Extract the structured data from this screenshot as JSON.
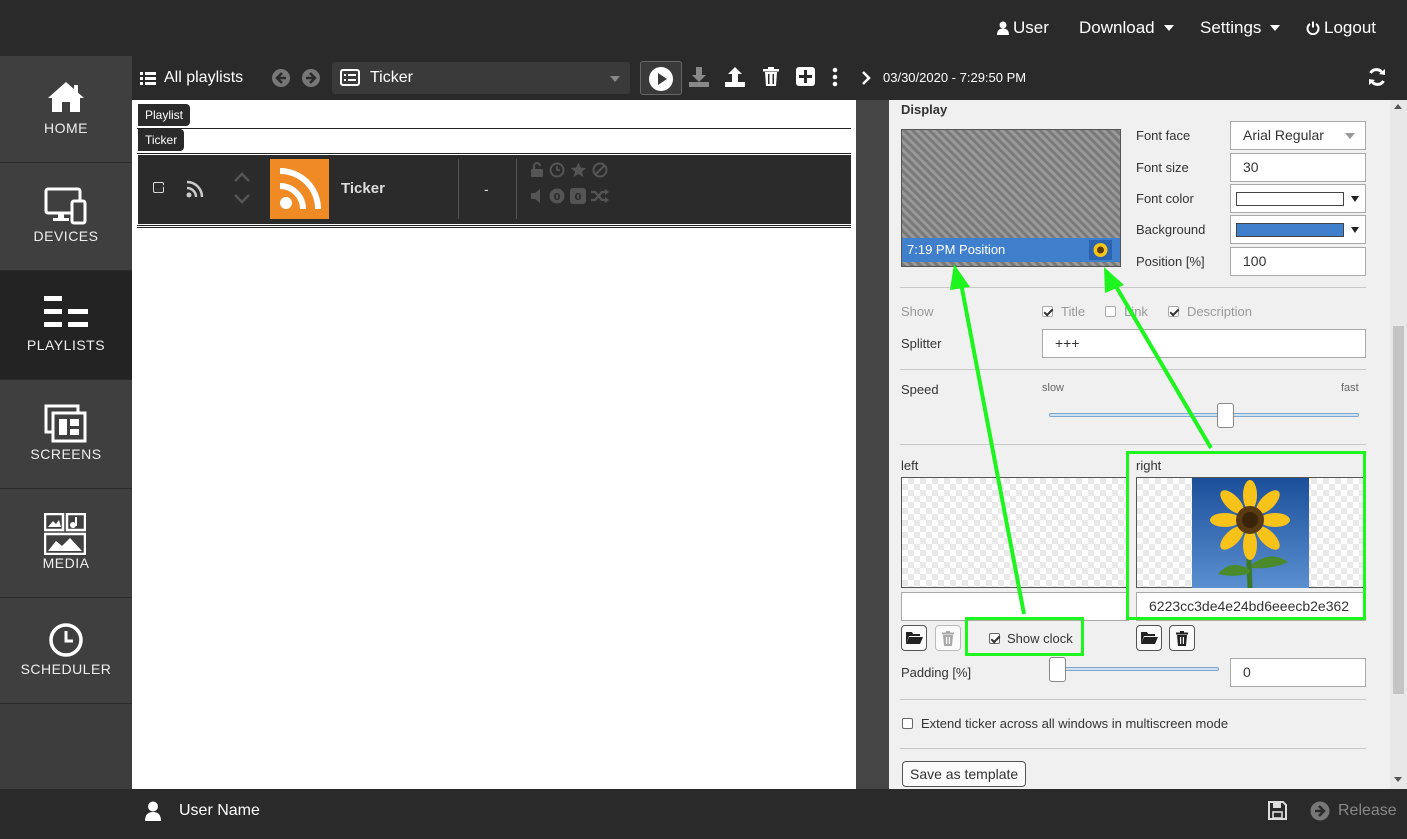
{
  "topbar": {
    "user_label": "User",
    "download_label": "Download",
    "settings_label": "Settings",
    "logout_label": "Logout"
  },
  "sidebar": {
    "items": [
      {
        "label": "HOME",
        "icon": "home-icon"
      },
      {
        "label": "DEVICES",
        "icon": "devices-icon"
      },
      {
        "label": "PLAYLISTS",
        "icon": "playlists-icon",
        "active": true
      },
      {
        "label": "SCREENS",
        "icon": "screens-icon"
      },
      {
        "label": "MEDIA",
        "icon": "media-icon"
      },
      {
        "label": "SCHEDULER",
        "icon": "clock-icon"
      }
    ]
  },
  "playlist_bar": {
    "all_playlists": "All playlists",
    "selected_playlist": "Ticker"
  },
  "playlist": {
    "tag_playlist": "Playlist",
    "tag_name": "Ticker",
    "row": {
      "title": "Ticker",
      "duration": "-"
    }
  },
  "right_bar": {
    "datetime": "03/30/2020 - 7:29:50 PM"
  },
  "display": {
    "section_title": "Display",
    "preview_ticker_text": "7:19 PM Position",
    "font_face_label": "Font face",
    "font_face_value": "Arial Regular",
    "font_size_label": "Font size",
    "font_size_value": "30",
    "font_color_label": "Font color",
    "font_color": "#ffffff",
    "background_label": "Background",
    "background_color": "#3f7fcc",
    "position_label": "Position [%]",
    "position_value": "100"
  },
  "show": {
    "label": "Show",
    "title_label": "Title",
    "title_checked": true,
    "link_label": "Link",
    "link_checked": false,
    "description_label": "Description",
    "description_checked": true
  },
  "splitter": {
    "label": "Splitter",
    "value": "+++"
  },
  "speed": {
    "label": "Speed",
    "slow_label": "slow",
    "fast_label": "fast",
    "value_fraction": 0.57
  },
  "images": {
    "left_label": "left",
    "left_value": "",
    "right_label": "right",
    "right_value": "6223cc3de4e24bd6eeecb2e362",
    "show_clock_label": "Show clock",
    "show_clock_checked": true
  },
  "padding": {
    "label": "Padding [%]",
    "value": "0",
    "value_fraction": 0.0
  },
  "extend": {
    "label": "Extend ticker across all windows in multiscreen mode",
    "checked": false
  },
  "save_template_label": "Save as template",
  "bottombar": {
    "user_name": "User Name",
    "release_label": "Release"
  }
}
